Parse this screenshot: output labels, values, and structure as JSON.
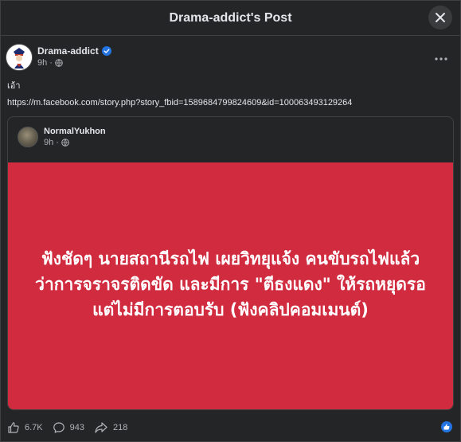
{
  "header": {
    "title": "Drama-addict's Post",
    "close_icon": "close-icon"
  },
  "post": {
    "author": "Drama-addict",
    "verified": true,
    "time": "9h",
    "audience_icon": "globe-icon",
    "text": "เอ้า",
    "link": "https://m.facebook.com/story.php?story_fbid=1589684799824609&id=100063493129264",
    "more_icon": "more-horizontal-icon"
  },
  "shared_post": {
    "author": "NormalYukhon",
    "time": "9h",
    "audience_icon": "globe-icon",
    "image_text": "ฟังชัดๆ นายสถานีรถไฟ เผยวิทยุแจ้ง คนขับรถไฟแล้วว่าการจราจรติดขัด และมีการ \"ตีธงแดง\" ให้รถหยุดรอ แต่ไม่มีการตอบรับ (ฟังคลิปคอมเมนต์)",
    "image_color": "#d12b3f"
  },
  "footer": {
    "likes": "6.7K",
    "comments": "943",
    "shares": "218"
  },
  "colors": {
    "background": "#242526",
    "text": "#e4e6eb",
    "secondary_text": "#b0b3b8",
    "accent": "#2374e1"
  }
}
